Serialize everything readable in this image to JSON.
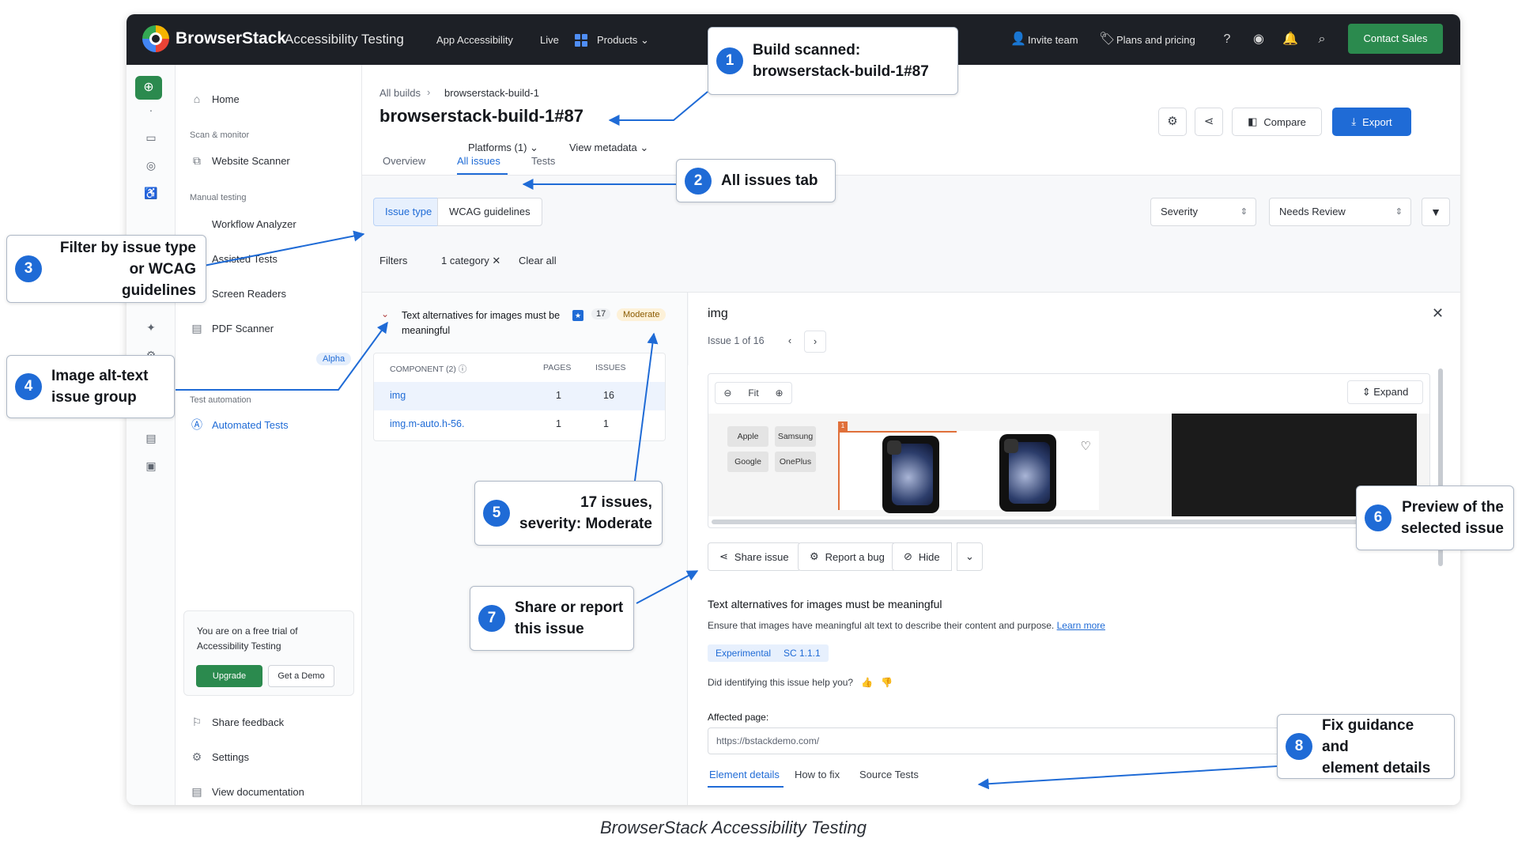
{
  "topbar": {
    "brand": "BrowserStack",
    "product": "Accessibility Testing",
    "nav": [
      "App Accessibility",
      "Live",
      "Products"
    ],
    "invite": "Invite team",
    "plans": "Plans and pricing",
    "contact": "Contact Sales"
  },
  "sidebar": {
    "home": "Home",
    "scan_head": "Scan & monitor",
    "website_scanner": "Website Scanner",
    "manual_head": "Manual testing",
    "workflow": "Workflow Analyzer",
    "assisted": "Assisted Tests",
    "screen_readers": "Screen Readers",
    "pdf": "PDF Scanner",
    "alpha": "Alpha",
    "auto_head": "Test automation",
    "automated": "Automated Tests",
    "trial_text": "You are on a free trial of Accessibility Testing",
    "upgrade": "Upgrade",
    "demo": "Get a Demo",
    "feedback": "Share feedback",
    "settings": "Settings",
    "docs": "View documentation"
  },
  "main": {
    "crumb_root": "All builds",
    "crumb_sep": "›",
    "crumb_build": "browserstack-build-1",
    "title": "browserstack-build-1#87",
    "platforms": "Platforms (1)",
    "view_metadata": "View metadata",
    "compare": "Compare",
    "export": "Export",
    "tabs": [
      "Overview",
      "All issues",
      "Tests"
    ],
    "seg_issue_type": "Issue type",
    "seg_wcag": "WCAG guidelines",
    "severity": "Severity",
    "needs_review": "Needs Review",
    "filters_label": "Filters",
    "filter_chip": "1 category",
    "clear_all": "Clear all"
  },
  "group": {
    "title": "Text alternatives for images must be meaningful",
    "count": "17",
    "severity": "Moderate",
    "col_component": "COMPONENT (2)",
    "col_pages": "PAGES",
    "col_issues": "ISSUES",
    "rows": [
      {
        "component": "img",
        "pages": "1",
        "issues": "16"
      },
      {
        "component": "img.m-auto.h-56.",
        "pages": "1",
        "issues": "1"
      }
    ]
  },
  "detail": {
    "title": "img",
    "issue_nav": "Issue 1 of 16",
    "fit": "Fit",
    "expand": "Expand",
    "brands": [
      "Apple",
      "Samsung",
      "Google",
      "OnePlus"
    ],
    "highlight_badge": "1",
    "share": "Share issue",
    "report": "Report a bug",
    "hide": "Hide",
    "issue_heading": "Text alternatives for images must be meaningful",
    "issue_desc": "Ensure that images have meaningful alt text to describe their content and purpose.",
    "learn_more": "Learn more",
    "tag1": "Experimental",
    "tag2": "SC 1.1.1",
    "helpful": "Did identifying this issue help you?",
    "affected_label": "Affected page:",
    "affected_url": "https://bstackdemo.com/",
    "bottom_tabs": [
      "Element details",
      "How to fix",
      "Source Tests"
    ]
  },
  "callouts": [
    {
      "n": "1",
      "text1": "Build scanned:",
      "text2": "browserstack-build-1#87"
    },
    {
      "n": "2",
      "text1": "All issues tab"
    },
    {
      "n": "3",
      "text1": "Filter by issue type",
      "text2": "or WCAG guidelines"
    },
    {
      "n": "4",
      "text1": "Image alt-text",
      "text2": "issue group"
    },
    {
      "n": "5",
      "text1": "17 issues,",
      "text2": "severity: Moderate"
    },
    {
      "n": "6",
      "text1": "Preview of the",
      "text2": "selected issue"
    },
    {
      "n": "7",
      "text1": "Share or report",
      "text2": "this issue"
    },
    {
      "n": "8",
      "text1": "Fix guidance and",
      "text2": "element details"
    }
  ],
  "caption": "BrowserStack Accessibility Testing",
  "colors": {
    "accent": "#1f6bd6",
    "brand_green": "#2b8a4e",
    "topbar": "#1d2026",
    "moderate": "#fdf1d8"
  }
}
